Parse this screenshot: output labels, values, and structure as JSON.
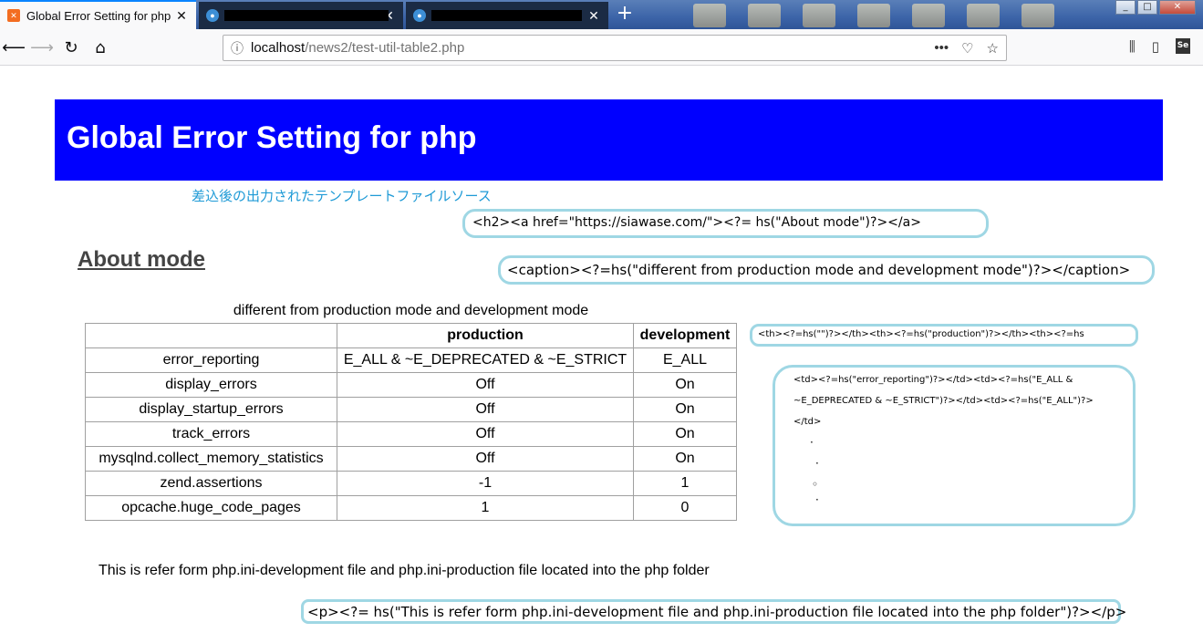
{
  "browser": {
    "tabs": [
      {
        "title": "Global Error Setting for php",
        "active": true,
        "close": "✕"
      },
      {
        "title": "",
        "active": false,
        "close": "✕"
      },
      {
        "title": "",
        "active": false,
        "close": "✕"
      }
    ],
    "new_tab": "+",
    "url_host": "localhost",
    "url_path": "/news2/test-util-table2.php"
  },
  "page": {
    "heading": "Global Error Setting for php",
    "jp_link": "差込後の出力されたテンプレートファイルソース",
    "about_heading": "About mode",
    "caption": "different from production mode and development mode",
    "table": {
      "headers": [
        "",
        "production",
        "development"
      ],
      "rows": [
        [
          "error_reporting",
          "E_ALL & ~E_DEPRECATED & ~E_STRICT",
          "E_ALL"
        ],
        [
          "display_errors",
          "Off",
          "On"
        ],
        [
          "display_startup_errors",
          "Off",
          "On"
        ],
        [
          "track_errors",
          "Off",
          "On"
        ],
        [
          "mysqlnd.collect_memory_statistics",
          "Off",
          "On"
        ],
        [
          "zend.assertions",
          "-1",
          "1"
        ],
        [
          "opcache.huge_code_pages",
          "1",
          "0"
        ]
      ]
    },
    "footer_text": "This is refer form php.ini-development file and php.ini-production file located into the php folder"
  },
  "callouts": {
    "h2_source": "<h2><a href=\"https://siawase.com/\"><?= hs(\"About mode\")?></a>",
    "caption_source": "<caption><?=hs(\"different from production mode and development mode\")?></caption>",
    "th_source": "<th><?=hs(\"\")?></th><th><?=hs(\"production\")?></th><th><?=hs",
    "td_source_lines": [
      "<td><?=hs(\"error_reporting\")?></td><td><?=hs(\"E_ALL &",
      "~E_DEPRECATED & ~E_STRICT\")?></td><td><?=hs(\"E_ALL\")?>",
      "</td>"
    ],
    "td_dots": [
      "·",
      "·",
      "◦",
      "·"
    ],
    "p_source": "<p><?= hs(\"This is refer form php.ini-development file and php.ini-production file located into the php folder\")?></p>"
  }
}
